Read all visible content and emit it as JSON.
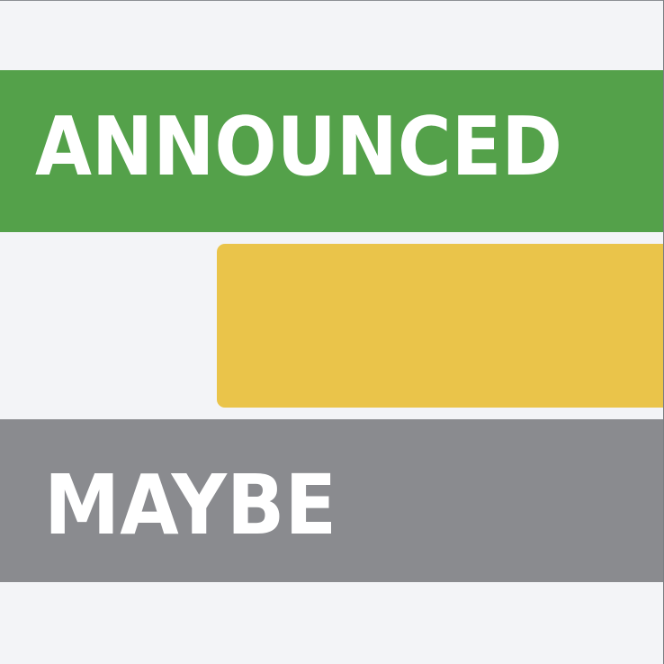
{
  "colors": {
    "background": "#f3f4f7",
    "announced": "#54a14a",
    "middle": "#eac44a",
    "maybe": "#8a8b8f",
    "text": "#ffffff"
  },
  "bands": {
    "announced": {
      "label": "ANNOUNCED"
    },
    "middle": {
      "label": ""
    },
    "maybe": {
      "label": "MAYBE"
    }
  }
}
